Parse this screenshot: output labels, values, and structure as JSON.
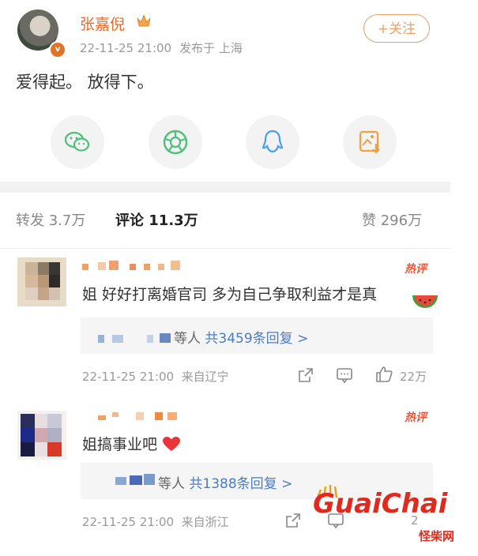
{
  "post": {
    "username": "张嘉倪",
    "time": "22-11-25 21:00",
    "location": "发布于 上海",
    "follow_label": "+关注",
    "content": "爱得起。 放得下。"
  },
  "share_icons": [
    "wechat-icon",
    "moments-icon",
    "qq-icon",
    "save-image-icon"
  ],
  "tabs": {
    "repost": "转发 3.7万",
    "comment": "评论 11.3万",
    "like": "赞 296万"
  },
  "comments": [
    {
      "badge": "热评",
      "text": "姐 好好打离婚官司 多为自己争取利益才是真",
      "reply_suffix": "等人",
      "reply_count": "共3459条回复 >",
      "time": "22-11-25 21:00",
      "location": "来自辽宁",
      "likes": "22万"
    },
    {
      "badge": "热评",
      "text": "姐搞事业吧",
      "reply_suffix": "等人",
      "reply_count": "共1388条回复 >",
      "time": "22-11-25 21:00",
      "location": "来自浙江",
      "likes": "2"
    }
  ],
  "watermark": {
    "logo": "GuaiChai",
    "sub": "怪柴网"
  },
  "colors": {
    "accent_orange": "#e86b2b",
    "link_blue": "#4a7cc2",
    "hot_red": "#e8583c",
    "watermark_red": "#e02a1e"
  }
}
